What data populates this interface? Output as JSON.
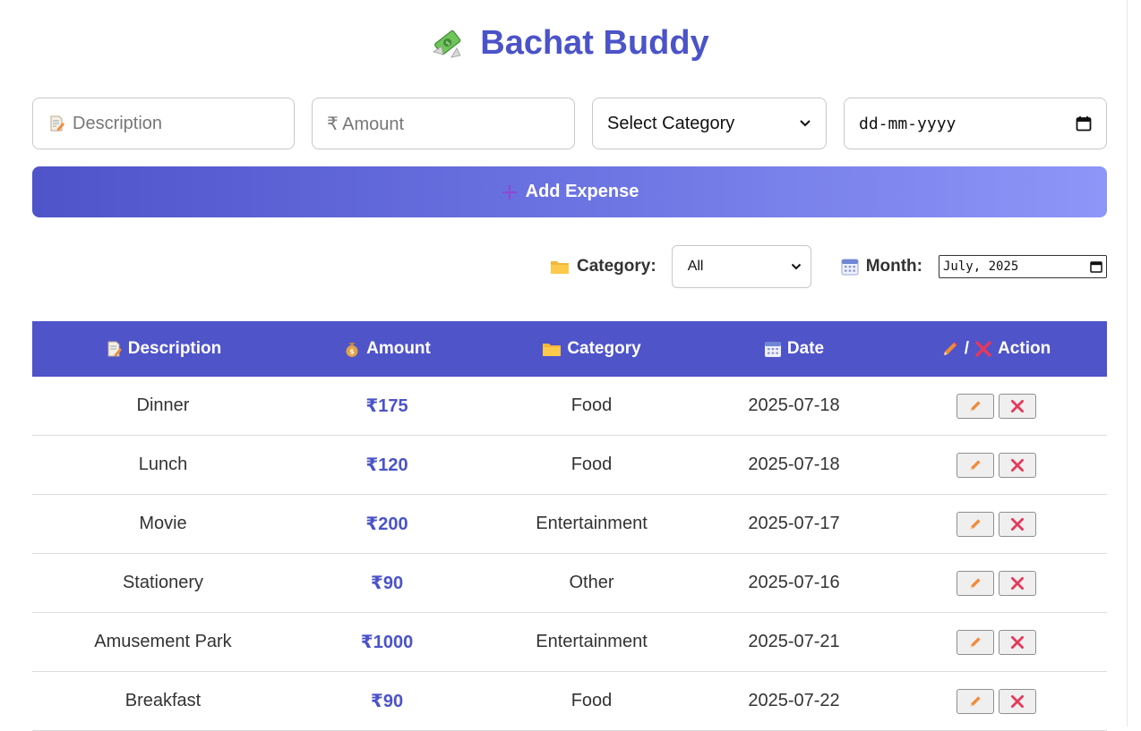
{
  "app": {
    "title": "Bachat Buddy"
  },
  "form": {
    "description_placeholder": "Description",
    "amount_placeholder": "₹ Amount",
    "category_select_value": "Select Category",
    "date_placeholder": "dd-mm-yyyy",
    "add_button_label": "Add Expense"
  },
  "filters": {
    "category_label": "Category:",
    "category_value": "All",
    "month_label": "Month:",
    "month_value": "July, 2025"
  },
  "table": {
    "headers": {
      "description": "Description",
      "amount": "Amount",
      "category": "Category",
      "date": "Date",
      "action": "Action",
      "action_separator": "/"
    },
    "rows": [
      {
        "description": "Dinner",
        "amount": "₹175",
        "category": "Food",
        "date": "2025-07-18"
      },
      {
        "description": "Lunch",
        "amount": "₹120",
        "category": "Food",
        "date": "2025-07-18"
      },
      {
        "description": "Movie",
        "amount": "₹200",
        "category": "Entertainment",
        "date": "2025-07-17"
      },
      {
        "description": "Stationery",
        "amount": "₹90",
        "category": "Other",
        "date": "2025-07-16"
      },
      {
        "description": "Amusement Park",
        "amount": "₹1000",
        "category": "Entertainment",
        "date": "2025-07-21"
      },
      {
        "description": "Breakfast",
        "amount": "₹90",
        "category": "Food",
        "date": "2025-07-22"
      }
    ]
  },
  "icons": {
    "title": "money-with-wings-icon",
    "description": "memo-icon",
    "amount": "money-bag-icon",
    "category": "folder-icon",
    "date": "calendar-icon",
    "edit": "pencil-icon",
    "delete": "cross-mark-icon",
    "add": "plus-icon"
  },
  "colors": {
    "accent": "#4f54c9",
    "title": "#4b53c8",
    "delete": "#e5395a",
    "edit": "#f08a3a"
  }
}
